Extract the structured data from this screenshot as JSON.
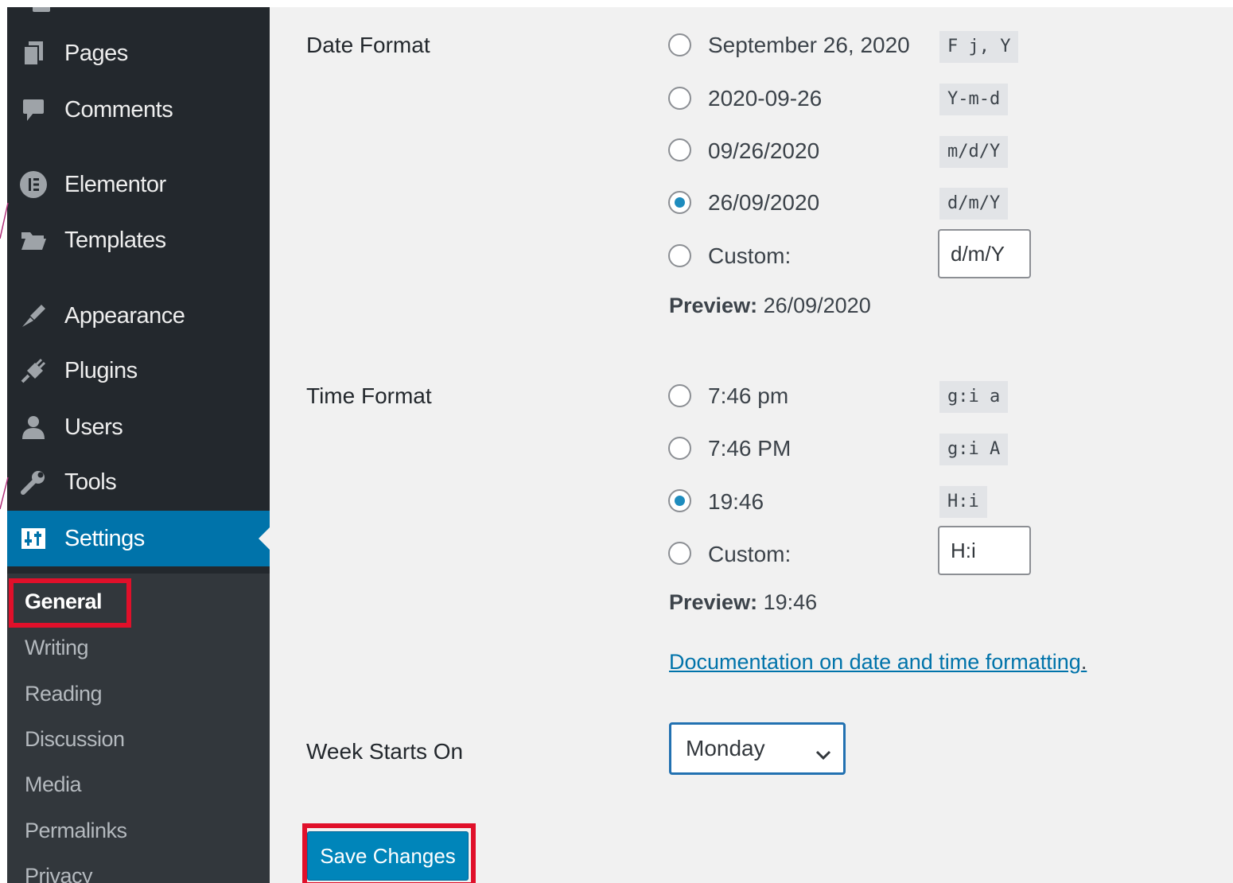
{
  "sidebar": {
    "menu": [
      {
        "label": "Pages",
        "icon": "pages-icon"
      },
      {
        "label": "Comments",
        "icon": "comments-icon"
      },
      {
        "label": "Elementor",
        "icon": "elementor-icon"
      },
      {
        "label": "Templates",
        "icon": "folder-icon"
      },
      {
        "label": "Appearance",
        "icon": "paintbrush-icon"
      },
      {
        "label": "Plugins",
        "icon": "plug-icon"
      },
      {
        "label": "Users",
        "icon": "user-icon"
      },
      {
        "label": "Tools",
        "icon": "wrench-icon"
      },
      {
        "label": "Settings",
        "icon": "settings-icon"
      }
    ],
    "submenu": [
      "General",
      "Writing",
      "Reading",
      "Discussion",
      "Media",
      "Permalinks",
      "Privacy"
    ]
  },
  "date_format": {
    "label": "Date Format",
    "options": [
      {
        "text": "September 26, 2020",
        "code": "F j, Y",
        "checked": false
      },
      {
        "text": "2020-09-26",
        "code": "Y-m-d",
        "checked": false
      },
      {
        "text": "09/26/2020",
        "code": "m/d/Y",
        "checked": false
      },
      {
        "text": "26/09/2020",
        "code": "d/m/Y",
        "checked": true
      }
    ],
    "custom_label": "Custom:",
    "custom_value": "d/m/Y",
    "preview_label": "Preview:",
    "preview_value": "26/09/2020"
  },
  "time_format": {
    "label": "Time Format",
    "options": [
      {
        "text": "7:46 pm",
        "code": "g:i a",
        "checked": false
      },
      {
        "text": "7:46 PM",
        "code": "g:i A",
        "checked": false
      },
      {
        "text": "19:46",
        "code": "H:i",
        "checked": true
      }
    ],
    "custom_label": "Custom:",
    "custom_value": "H:i",
    "preview_label": "Preview:",
    "preview_value": "19:46"
  },
  "documentation_link": "Documentation on date and time formatting",
  "documentation_period": ".",
  "week_starts_on": {
    "label": "Week Starts On",
    "selected": "Monday"
  },
  "save_button": "Save Changes",
  "colors": {
    "sidebar_bg": "#23282d",
    "accent": "#0073aa",
    "highlight": "#e0102a"
  }
}
